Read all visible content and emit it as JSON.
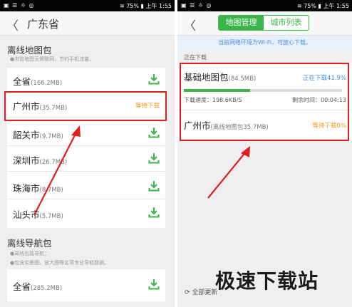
{
  "status": {
    "left_icons": "▣ ☰ ☼ ◎",
    "wifi": "≋",
    "battery": "75%",
    "time": "上午 1:55"
  },
  "left": {
    "title": "广东省",
    "offline_map": {
      "heading": "离线地图包",
      "hint": "●浏览地图无需联网，节约手机流量。",
      "items": [
        {
          "name": "全省",
          "size": "(166.2MB)",
          "status": ""
        },
        {
          "name": "广州市",
          "size": "(35.7MB)",
          "status": "等待下载"
        },
        {
          "name": "韶关市",
          "size": "(9.7MB)",
          "status": ""
        },
        {
          "name": "深圳市",
          "size": "(26.7MB)",
          "status": ""
        },
        {
          "name": "珠海市",
          "size": "(8.7MB)",
          "status": ""
        },
        {
          "name": "汕头市",
          "size": "(5.7MB)",
          "status": ""
        }
      ]
    },
    "nav": {
      "heading": "离线导航包",
      "hint1": "●离线也能导航；",
      "hint2": "●包含实景图、放大图等名项专业导航数据。",
      "item": {
        "name": "全省",
        "size": "(285.2MB)"
      }
    }
  },
  "right": {
    "tab_map": "地图管理",
    "tab_city": "城市列表",
    "banner": "当前网络环境为Wi-Fi，可放心下载。",
    "downloading": "正在下载",
    "base": {
      "name": "基础地图包",
      "size": "(84.5MB)",
      "status": "正在下载41.9%",
      "progress": 41.9,
      "speed": "下载速度：198.6KB/S",
      "remain": "剩余时间：00:04:13"
    },
    "gz": {
      "name": "广州市",
      "size": "(离线地图包35.7MB)",
      "status": "等待下载0%"
    },
    "update_all": "全部更新"
  },
  "colors": {
    "accent": "#3bb54a",
    "wait": "#f39a1d",
    "blue": "#3a8ee6",
    "red": "#e01e1e"
  },
  "watermark": "极速下载站"
}
